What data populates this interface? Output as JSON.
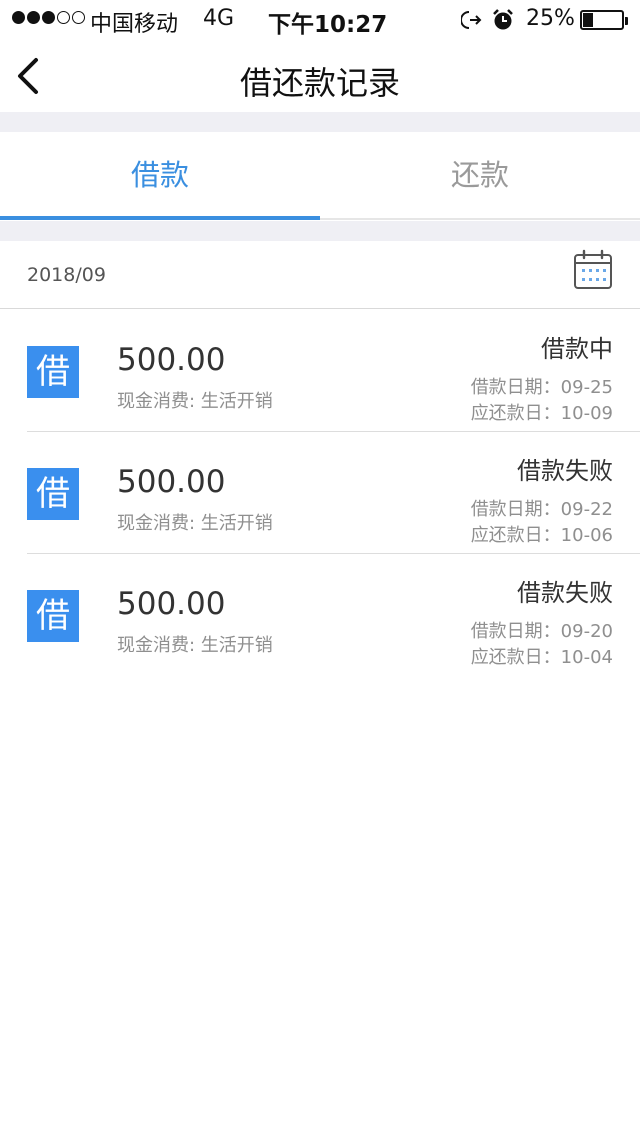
{
  "status_bar": {
    "carrier": "中国移动",
    "network": "4G",
    "time": "下午10:27",
    "battery": "25%",
    "battery_level": 0.25
  },
  "nav": {
    "title": "借还款记录",
    "back_icon": "chevron-left-icon"
  },
  "tabs": [
    {
      "label": "借款",
      "active": true
    },
    {
      "label": "还款",
      "active": false
    }
  ],
  "month": {
    "label": "2018/09",
    "icon": "calendar-icon"
  },
  "colors": {
    "accent": "#3a8fe0",
    "badge": "#3a8fee",
    "background_band": "#efeff4"
  },
  "records": [
    {
      "badge": "借",
      "amount": "500.00",
      "desc": "现金消费: 生活开销",
      "status": "借款中",
      "loan_date": "借款日期：09-25",
      "due_date": "应还款日：10-09"
    },
    {
      "badge": "借",
      "amount": "500.00",
      "desc": "现金消费: 生活开销",
      "status": "借款失败",
      "loan_date": "借款日期：09-22",
      "due_date": "应还款日：10-06"
    },
    {
      "badge": "借",
      "amount": "500.00",
      "desc": "现金消费: 生活开销",
      "status": "借款失败",
      "loan_date": "借款日期：09-20",
      "due_date": "应还款日：10-04"
    }
  ]
}
